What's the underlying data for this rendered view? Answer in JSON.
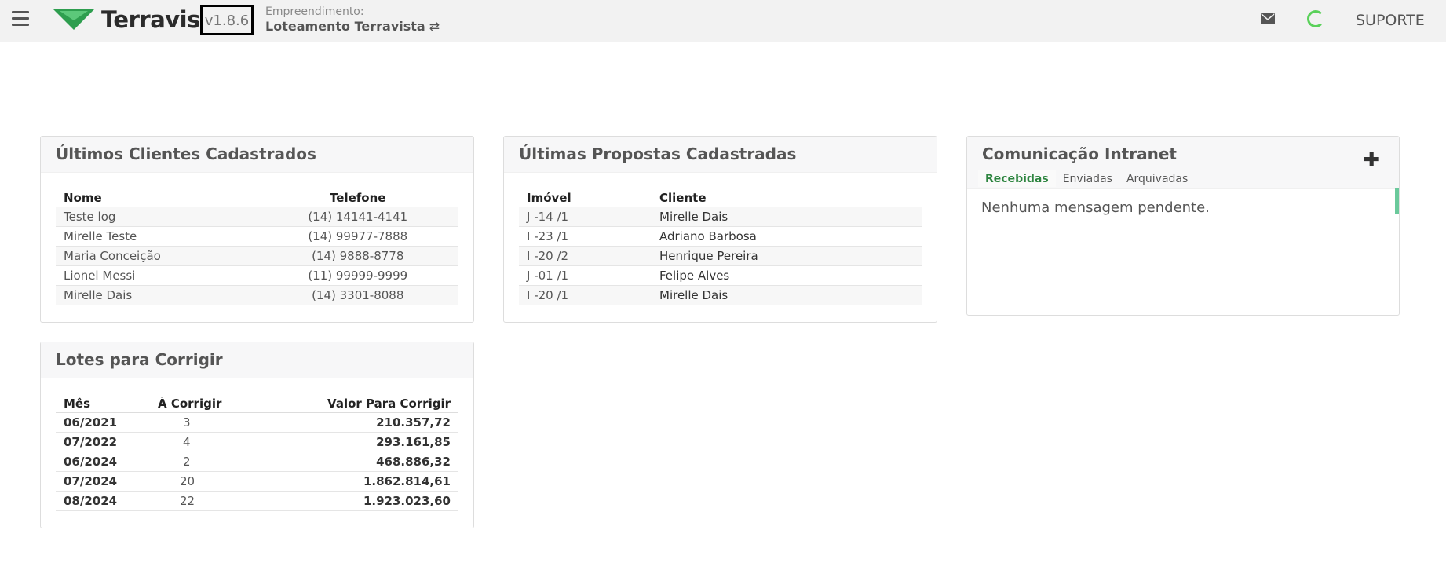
{
  "header": {
    "logo_text": "Terravista",
    "version": "v1.8.6",
    "empreendimento_label": "Empreendimento:",
    "empreendimento_name": "Loteamento Terravista",
    "switch_glyph": "⇄",
    "support_label": "SUPORTE",
    "brand_color": "#2e9e4f"
  },
  "clientes": {
    "title": "Últimos Clientes Cadastrados",
    "columns": [
      "Nome",
      "Telefone"
    ],
    "rows": [
      {
        "nome": "Teste log",
        "telefone": "(14) 14141-4141"
      },
      {
        "nome": "Mirelle Teste",
        "telefone": "(14) 99977-7888"
      },
      {
        "nome": "Maria Conceição",
        "telefone": "(14) 9888-8778"
      },
      {
        "nome": "Lionel Messi",
        "telefone": "(11) 99999-9999"
      },
      {
        "nome": "Mirelle Dais",
        "telefone": "(14) 3301-8088"
      }
    ]
  },
  "propostas": {
    "title": "Últimas Propostas Cadastradas",
    "columns": [
      "Imóvel",
      "Cliente"
    ],
    "rows": [
      {
        "imovel": "J -14 /1",
        "cliente": "Mirelle Dais"
      },
      {
        "imovel": "I -23 /1",
        "cliente": "Adriano Barbosa"
      },
      {
        "imovel": "I -20 /2",
        "cliente": "Henrique Pereira"
      },
      {
        "imovel": "J -01 /1",
        "cliente": "Felipe Alves"
      },
      {
        "imovel": "I -20 /1",
        "cliente": "Mirelle Dais"
      }
    ]
  },
  "intranet": {
    "title": "Comunicação Intranet",
    "add_glyph": "✚",
    "tabs": [
      "Recebidas",
      "Enviadas",
      "Arquivadas"
    ],
    "active_tab": "Recebidas",
    "empty_message": "Nenhuma mensagem pendente."
  },
  "lotes": {
    "title": "Lotes para Corrigir",
    "columns": [
      "Mês",
      "À Corrigir",
      "Valor Para Corrigir"
    ],
    "rows": [
      {
        "mes": "06/2021",
        "corrigir": "3",
        "valor": "210.357,72"
      },
      {
        "mes": "07/2022",
        "corrigir": "4",
        "valor": "293.161,85"
      },
      {
        "mes": "06/2024",
        "corrigir": "2",
        "valor": "468.886,32"
      },
      {
        "mes": "07/2024",
        "corrigir": "20",
        "valor": "1.862.814,61"
      },
      {
        "mes": "08/2024",
        "corrigir": "22",
        "valor": "1.923.023,60"
      }
    ]
  }
}
